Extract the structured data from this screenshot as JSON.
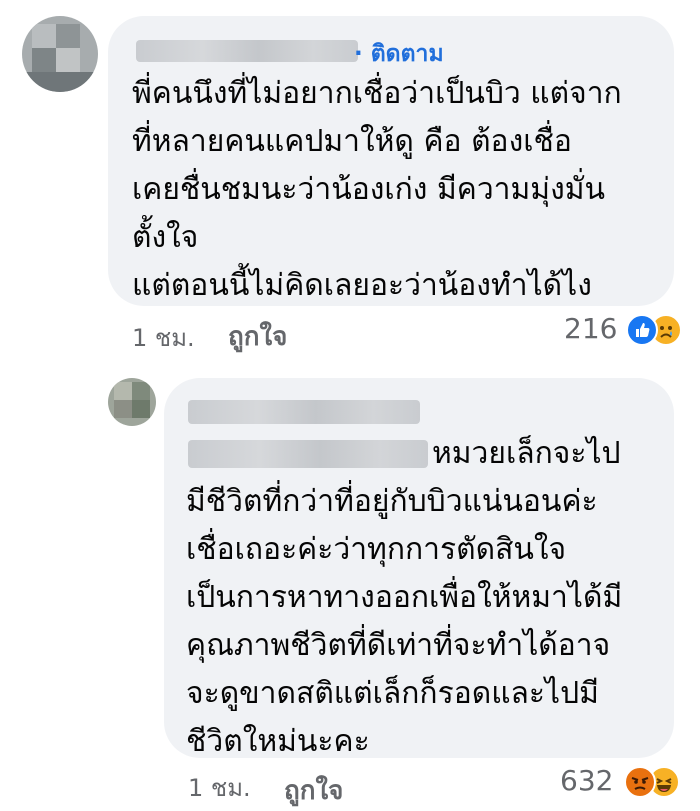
{
  "comment1": {
    "follow_label": "· ติดตาม",
    "lines": [
      "พี่คนนึงที่ไม่อยากเชื่อว่าเป็นบิว แต่จาก",
      "ที่หลายคนแคปมาให้ดู คือ ต้องเชื่อ",
      "เคยชื่นชมนะว่าน้องเก่ง มีความมุ่งมั่น",
      "ตั้งใจ",
      "แต่ตอนนี้ไม่คิดเลยอะว่าน้องทำได้ไง"
    ],
    "time": "1 ชม.",
    "like_label": "ถูกใจ",
    "reaction_count": "216",
    "reactions": [
      "like-icon",
      "sad-icon"
    ],
    "colors": {
      "like": "#1877f2",
      "sad": "#f7b125"
    }
  },
  "reply1": {
    "lines": [
      "หมวยเล็กจะไป",
      "มีชีวิตที่กว่าที่อยู่กับบิวแน่นอนค่ะ",
      "เชื่อเถอะค่ะว่าทุกการตัดสินใจ",
      "เป็นการหาทางออกเพื่อให้หมาได้มี",
      "คุณภาพชีวิตที่ดีเท่าที่จะทำได้อาจ",
      "จะดูขาดสติแต่เล็กก็รอดและไปมี",
      "ชีวิตใหม่นะคะ"
    ],
    "time": "1 ชม.",
    "like_label": "ถูกใจ",
    "reaction_count": "632",
    "reactions": [
      "angry-icon",
      "haha-icon"
    ],
    "colors": {
      "angry": "#e9710f",
      "haha": "#f7b125"
    }
  }
}
